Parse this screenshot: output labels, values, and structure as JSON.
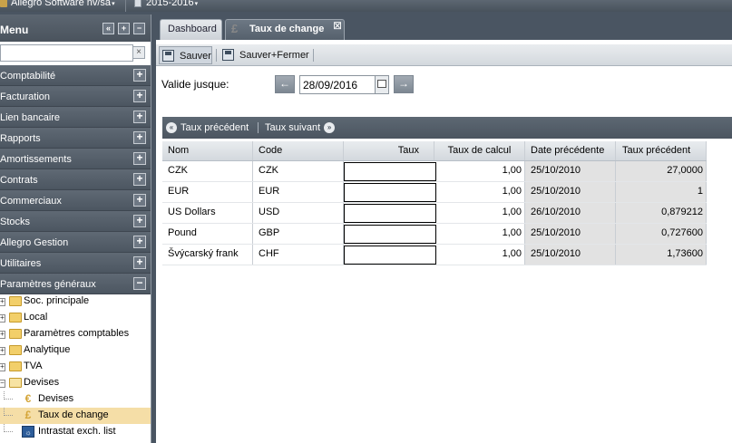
{
  "topbar": {
    "company": "Allegro Software nv/sa",
    "year": "2015-2016"
  },
  "menu": {
    "title": "Menu",
    "search_value": "",
    "items": [
      {
        "label": "Comptabilité",
        "toggle": "+"
      },
      {
        "label": "Facturation",
        "toggle": "+"
      },
      {
        "label": "Lien bancaire",
        "toggle": "+"
      },
      {
        "label": "Rapports",
        "toggle": "+"
      },
      {
        "label": "Amortissements",
        "toggle": "+"
      },
      {
        "label": "Contrats",
        "toggle": "+"
      },
      {
        "label": "Commerciaux",
        "toggle": "+"
      },
      {
        "label": "Stocks",
        "toggle": "+"
      },
      {
        "label": "Allegro Gestion",
        "toggle": "+"
      },
      {
        "label": "Utilitaires",
        "toggle": "+"
      },
      {
        "label": "Paramètres généraux",
        "toggle": "−"
      }
    ],
    "tree": {
      "folders": [
        {
          "label": "Soc. principale",
          "expander": "+"
        },
        {
          "label": "Local",
          "expander": "+"
        },
        {
          "label": "Paramètres comptables",
          "expander": "+"
        },
        {
          "label": "Analytique",
          "expander": "+"
        },
        {
          "label": "TVA",
          "expander": "+"
        },
        {
          "label": "Devises",
          "expander": "−"
        }
      ],
      "children": [
        {
          "label": "Devises",
          "icon": "euro-icon",
          "glyph": "€"
        },
        {
          "label": "Taux de change",
          "icon": "exchange-rate-icon",
          "glyph": "£"
        },
        {
          "label": "Intrastat exch. list",
          "icon": "eu-flag-icon",
          "glyph": "☼"
        }
      ]
    }
  },
  "tabs": [
    {
      "label": "Dashboard",
      "active": false
    },
    {
      "label": "Taux de change",
      "active": true
    }
  ],
  "toolbar": {
    "save_label": "Sauver",
    "save_close_label": "Sauver+Fermer"
  },
  "validity": {
    "label": "Valide jusque:",
    "date": "28/09/2016"
  },
  "rates_nav": {
    "prev_label": "Taux précédent",
    "next_label": "Taux suivant"
  },
  "grid": {
    "columns": [
      "Nom",
      "Code",
      "Taux",
      "Taux de calcul",
      "Date précédente",
      "Taux précédent"
    ],
    "rows": [
      {
        "nom": "CZK",
        "code": "CZK",
        "taux": "",
        "calcul": "1,00",
        "date": "25/10/2010",
        "precedent": "27,0000"
      },
      {
        "nom": "EUR",
        "code": "EUR",
        "taux": "",
        "calcul": "1,00",
        "date": "25/10/2010",
        "precedent": "1"
      },
      {
        "nom": "US Dollars",
        "code": "USD",
        "taux": "",
        "calcul": "1,00",
        "date": "26/10/2010",
        "precedent": "0,879212"
      },
      {
        "nom": "Pound",
        "code": "GBP",
        "taux": "",
        "calcul": "1,00",
        "date": "25/10/2010",
        "precedent": "0,727600"
      },
      {
        "nom": "Švýcarský frank",
        "code": "CHF",
        "taux": "",
        "calcul": "1,00",
        "date": "25/10/2010",
        "precedent": "1,73600"
      }
    ]
  }
}
